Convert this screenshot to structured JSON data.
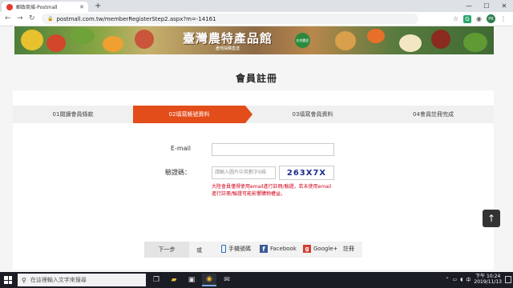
{
  "browser": {
    "tab_title": "郵政商城-Postmall",
    "new_tab": "+",
    "url": "postmall.com.tw/memberRegisterStep2.aspx?m=-14161",
    "ext_initial": "G",
    "avatar_text": "PR"
  },
  "banner": {
    "title": "臺灣農特產品館",
    "subtitle": "產地採購直送",
    "seal": "在地農民"
  },
  "page": {
    "heading": "會員註冊"
  },
  "steps": [
    {
      "label": "01閱讀會員條款"
    },
    {
      "label": "02填寫帳號資料",
      "active": true
    },
    {
      "label": "03填寫會員資料"
    },
    {
      "label": "04會員註冊完成"
    }
  ],
  "form": {
    "email_label": "E-mail",
    "email_value": "",
    "captcha_label": "驗證碼：",
    "captcha_placeholder": "請輸入圖片中英數字6碼",
    "captcha_code": "263X7X",
    "note": "大陸會員僅得使用email進行註冊/驗證，若未使用email進行註冊/驗證可能影響購物權益。"
  },
  "actions": {
    "next": "下一步",
    "or": "或",
    "phone": "手機號碼",
    "facebook": "Facebook",
    "google": "Google+",
    "register": "註冊"
  },
  "taskbar": {
    "search_placeholder": "在這裡輸入文字來搜尋",
    "time": "下午 10:24",
    "date": "2019/11/13",
    "lang": "中"
  },
  "colors": {
    "accent": "#e34d1a",
    "captcha_text": "#1a2b8c",
    "note_text": "#d0021b",
    "facebook": "#3b5998",
    "google": "#d23f31"
  }
}
